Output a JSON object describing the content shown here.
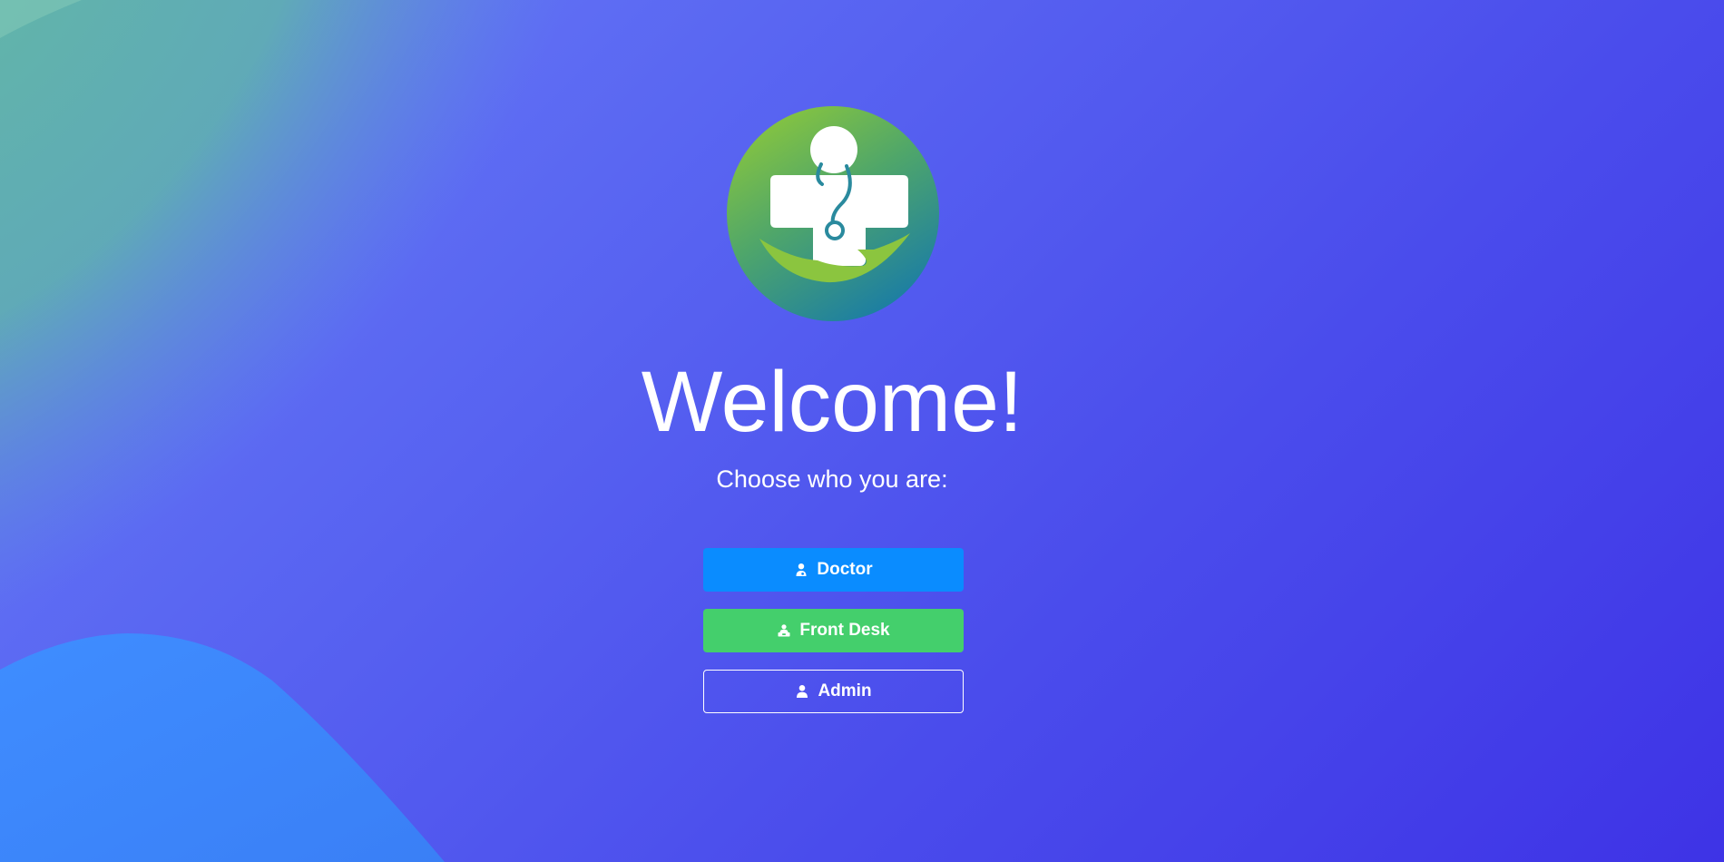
{
  "logo": {
    "icon": "medical-care-logo",
    "colors": [
      "#8bc53f",
      "#1a7fa0",
      "#ffffff"
    ]
  },
  "heading": "Welcome!",
  "subtitle": "Choose who you are:",
  "roles": [
    {
      "label": "Doctor",
      "icon": "doctor-icon",
      "color": "#0a8cff"
    },
    {
      "label": "Front Desk",
      "icon": "front-desk-icon",
      "color": "#44cf6c"
    },
    {
      "label": "Admin",
      "icon": "user-icon",
      "color": "transparent"
    }
  ],
  "background": {
    "gradient": [
      "#6a7ef7",
      "#3e33e6"
    ],
    "accent_top_left": "#5fb8a8",
    "accent_bottom_left": "#3a8bff"
  }
}
